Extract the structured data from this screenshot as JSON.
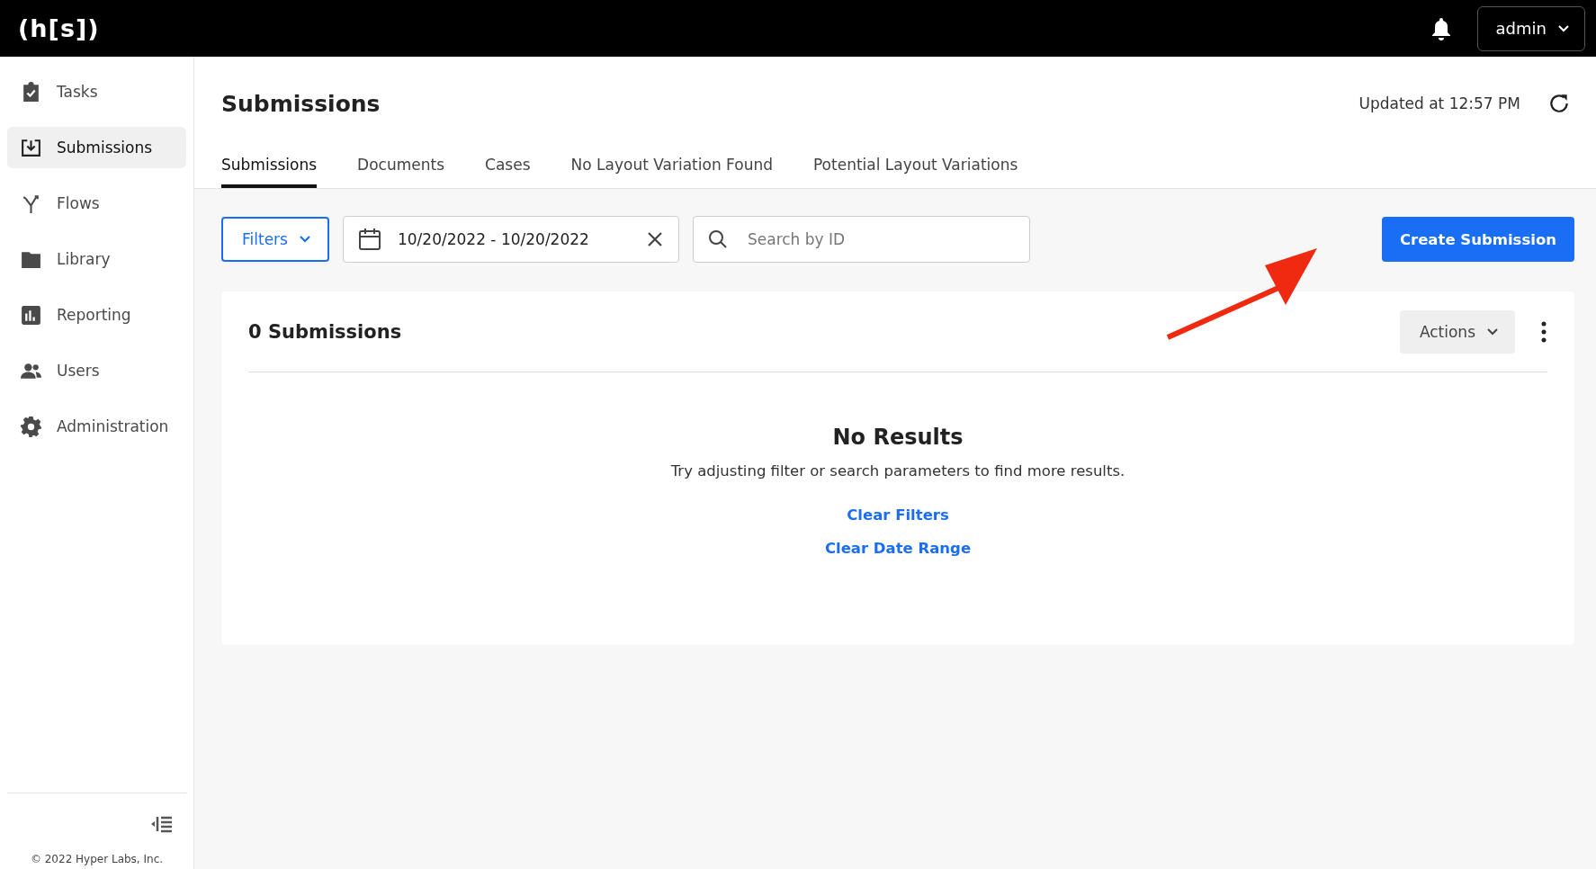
{
  "header": {
    "logo": "(h[s])",
    "user_menu": "admin"
  },
  "sidebar": {
    "items": [
      {
        "kind": "tasks",
        "label": "Tasks",
        "selected": false
      },
      {
        "kind": "submissions",
        "label": "Submissions",
        "selected": true
      },
      {
        "kind": "flows",
        "label": "Flows",
        "selected": false
      },
      {
        "kind": "library",
        "label": "Library",
        "selected": false
      },
      {
        "kind": "reporting",
        "label": "Reporting",
        "selected": false
      },
      {
        "kind": "users",
        "label": "Users",
        "selected": false
      },
      {
        "kind": "administration",
        "label": "Administration",
        "selected": false
      }
    ],
    "copyright": "© 2022 Hyper Labs, Inc."
  },
  "page": {
    "title": "Submissions",
    "updated": "Updated at 12:57 PM"
  },
  "tabs": [
    {
      "label": "Submissions",
      "selected": true
    },
    {
      "label": "Documents",
      "selected": false
    },
    {
      "label": "Cases",
      "selected": false
    },
    {
      "label": "No Layout Variation Found",
      "selected": false
    },
    {
      "label": "Potential Layout Variations",
      "selected": false
    }
  ],
  "toolbar": {
    "filters": "Filters",
    "date_range": "10/20/2022 - 10/20/2022",
    "search": {
      "placeholder": "Search by ID"
    },
    "create_button": "Create Submission"
  },
  "results": {
    "count": "0 Submissions",
    "actions": "Actions",
    "empty_title": "No Results",
    "empty_text": "Try adjusting filter or search parameters to find more results.",
    "links": [
      "Clear Filters",
      "Clear Date Range"
    ]
  }
}
